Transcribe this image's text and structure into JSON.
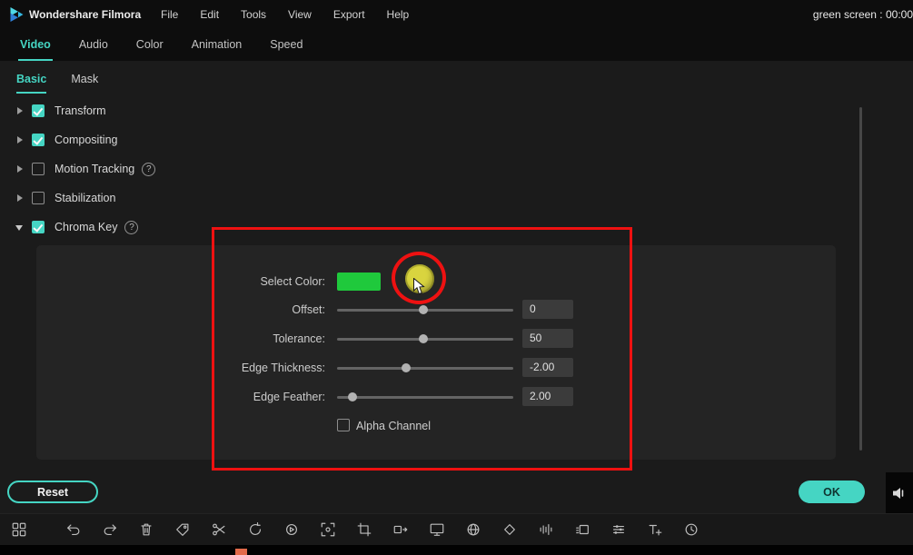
{
  "window": {
    "app_title": "Wondershare Filmora",
    "project_label": "green screen : 00:00"
  },
  "menubar": {
    "items": [
      "File",
      "Edit",
      "Tools",
      "View",
      "Export",
      "Help"
    ]
  },
  "tabs": {
    "active": "Video",
    "items": [
      "Video",
      "Audio",
      "Color",
      "Animation",
      "Speed"
    ]
  },
  "subtabs": {
    "active": "Basic",
    "items": [
      "Basic",
      "Mask"
    ]
  },
  "properties": {
    "items": [
      {
        "label": "Transform",
        "checked": true,
        "expanded": false,
        "help": false
      },
      {
        "label": "Compositing",
        "checked": true,
        "expanded": false,
        "help": false
      },
      {
        "label": "Motion Tracking",
        "checked": false,
        "expanded": false,
        "help": true
      },
      {
        "label": "Stabilization",
        "checked": false,
        "expanded": false,
        "help": false
      },
      {
        "label": "Chroma Key",
        "checked": true,
        "expanded": true,
        "help": true
      }
    ]
  },
  "chroma_key": {
    "select_color_label": "Select Color:",
    "selected_color": "#1fc93c",
    "picker_highlight_color": "#d9d43f",
    "sliders": [
      {
        "label": "Offset:",
        "value": "0",
        "percent": 49
      },
      {
        "label": "Tolerance:",
        "value": "50",
        "percent": 49
      },
      {
        "label": "Edge Thickness:",
        "value": "-2.00",
        "percent": 39
      },
      {
        "label": "Edge Feather:",
        "value": "2.00",
        "percent": 9
      }
    ],
    "alpha_channel_label": "Alpha Channel"
  },
  "actions": {
    "reset_label": "Reset",
    "ok_label": "OK"
  },
  "toolbar": {
    "icons": [
      "media-grid",
      "undo",
      "redo",
      "delete",
      "marker",
      "split",
      "speed",
      "play-circle",
      "snapshot",
      "crop",
      "ripple-edit",
      "screen-record",
      "globe",
      "keyframe",
      "audio-wave",
      "motion-blur",
      "adjust",
      "add-text",
      "timer"
    ]
  },
  "colors": {
    "accent": "#45d5c3",
    "annotation_red": "#ee1111",
    "swatch_green": "#1fc93c",
    "picker_yellow": "#d9d43f"
  }
}
